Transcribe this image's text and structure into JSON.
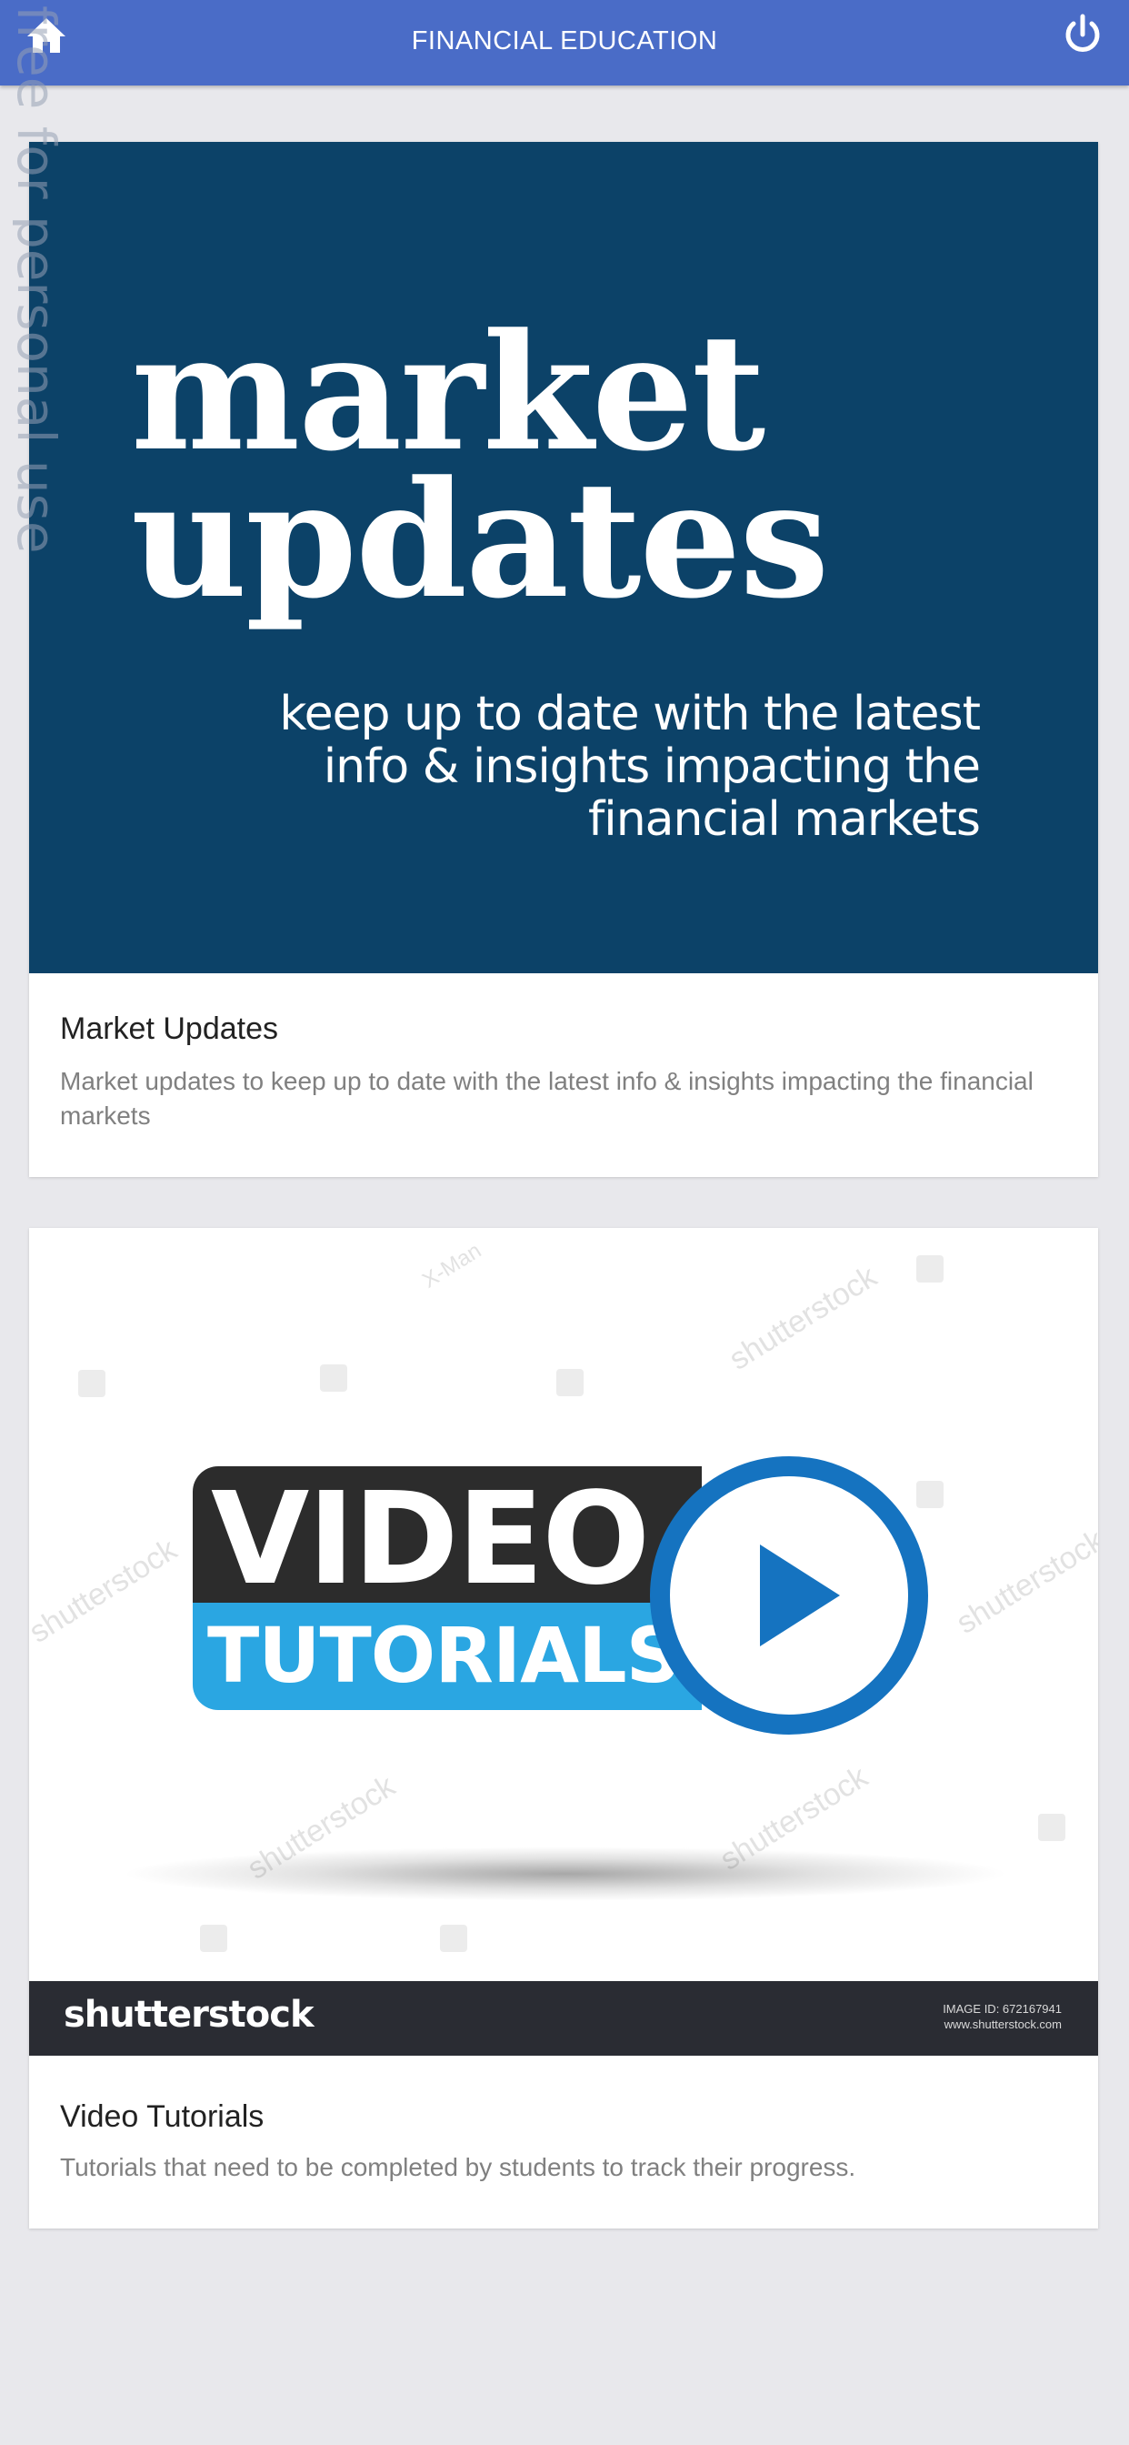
{
  "header": {
    "title": "FINANCIAL EDUCATION",
    "home_icon": "home-icon",
    "power_icon": "power-icon"
  },
  "side_watermark": "free for personal use",
  "cards": [
    {
      "banner": {
        "headline_line1": "market",
        "headline_line2": "updates",
        "sub_line1": "keep up to date with the latest",
        "sub_line2": "info & insights impacting the",
        "sub_line3": "financial markets"
      },
      "title": "Market Updates",
      "description": "Market updates to keep up to date with the latest info & insights impacting the financial markets"
    },
    {
      "banner": {
        "word1": "VIDEO",
        "word2": "TUTORIALS",
        "watermark1": "shutterstock",
        "watermark2": "X-Man",
        "footer_brand": "shutterstock",
        "image_id_line1": "IMAGE ID: 672167941",
        "image_id_line2": "www.shutterstock.com"
      },
      "title": "Video Tutorials",
      "description": "Tutorials that need to be completed by students to track their progress."
    }
  ],
  "colors": {
    "header_bg": "#4a6cc7",
    "page_bg": "#e8e8ec",
    "market_banner_bg": "#0c4268",
    "video_dark": "#2c2c2c",
    "video_blue": "#2aa6e2",
    "play_blue": "#1573c0"
  }
}
